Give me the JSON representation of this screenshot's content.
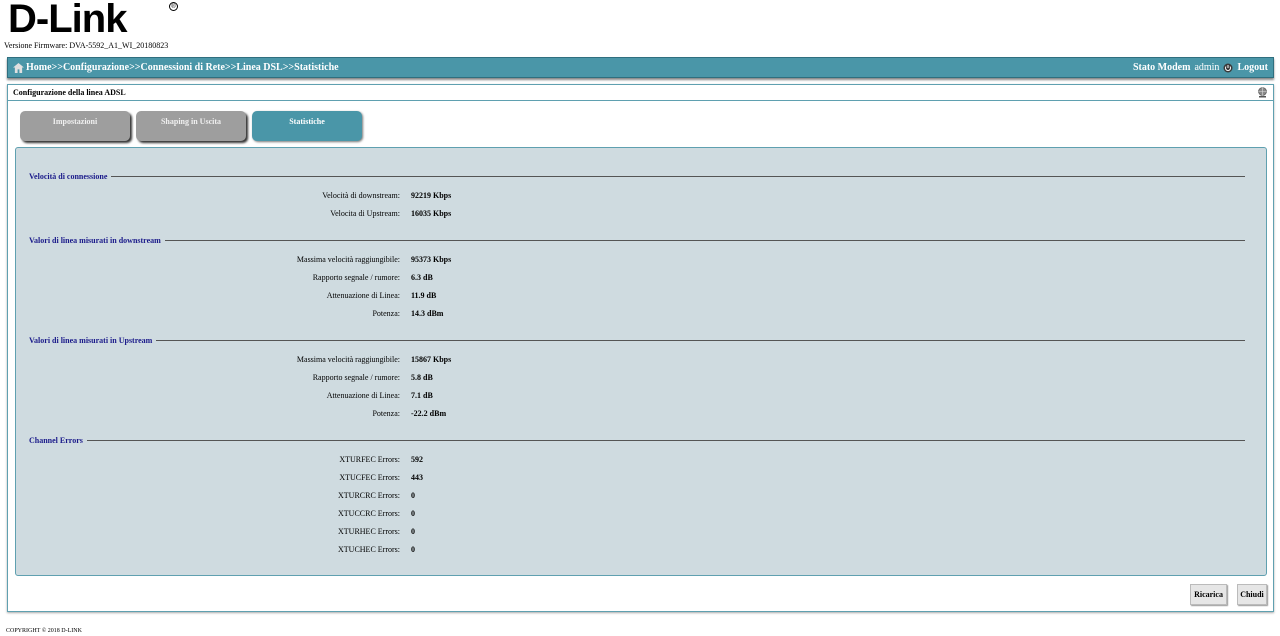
{
  "header": {
    "logo": "D-Link",
    "logo_reg": "®",
    "firmware": "Versione Firmware: DVA-5592_A1_WI_20180823"
  },
  "nav": {
    "breadcrumb": [
      "Home",
      "Configurazione",
      "Connessioni di Rete",
      "Linea DSL",
      "Statistiche"
    ],
    "separator": ">>",
    "status_link": "Stato Modem",
    "user": "admin",
    "logout": "Logout",
    "icons": {
      "home": "home-icon",
      "logout": "logout-icon"
    }
  },
  "panel": {
    "title": "Configurazione della linea ADSL",
    "icon": "help-globe-icon",
    "tabs": [
      {
        "label": "Impostazioni",
        "active": false
      },
      {
        "label": "Shaping in Uscita",
        "active": false
      },
      {
        "label": "Statistiche",
        "active": true
      }
    ]
  },
  "sections": [
    {
      "title": "Velocità di connessione",
      "rows": [
        {
          "label": "Velocità di downstream:",
          "value": "92219 Kbps"
        },
        {
          "label": "Velocita di Upstream:",
          "value": "16035 Kbps"
        }
      ]
    },
    {
      "title": "Valori di linea misurati in downstream",
      "rows": [
        {
          "label": "Massima velocità raggiungibile:",
          "value": "95373 Kbps"
        },
        {
          "label": "Rapporto segnale / rumore:",
          "value": "6.3 dB"
        },
        {
          "label": "Attenuazione di Linea:",
          "value": "11.9 dB"
        },
        {
          "label": "Potenza:",
          "value": "14.3 dBm"
        }
      ]
    },
    {
      "title": "Valori di linea misurati in Upstream",
      "rows": [
        {
          "label": "Massima velocità raggiungibile:",
          "value": "15867 Kbps"
        },
        {
          "label": "Rapporto segnale / rumore:",
          "value": "5.8 dB"
        },
        {
          "label": "Attenuazione di Linea:",
          "value": "7.1 dB"
        },
        {
          "label": "Potenza:",
          "value": "-22.2 dBm"
        }
      ]
    },
    {
      "title": "Channel Errors",
      "rows": [
        {
          "label": "XTURFEC Errors:",
          "value": "592"
        },
        {
          "label": "XTUCFEC Errors:",
          "value": "443"
        },
        {
          "label": "XTURCRC Errors:",
          "value": "0"
        },
        {
          "label": "XTUCCRC Errors:",
          "value": "0"
        },
        {
          "label": "XTURHEC Errors:",
          "value": "0"
        },
        {
          "label": "XTUCHEC Errors:",
          "value": "0"
        }
      ]
    }
  ],
  "buttons": {
    "reload": "Ricarica",
    "close": "Chiudi"
  },
  "footer": {
    "copyright": "COPYRIGHT © 2018 D-LINK"
  },
  "colors": {
    "accent": "#4a96a8",
    "content_bg": "#cfdbe0",
    "section_title": "#1a1a8a",
    "tab_inactive": "#9e9e9e"
  }
}
